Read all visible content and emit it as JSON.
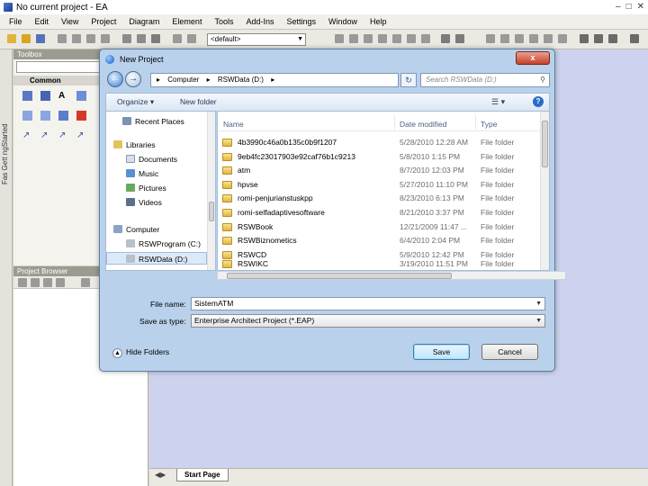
{
  "app": {
    "title": "No current project - EA",
    "menu": [
      "File",
      "Edit",
      "View",
      "Project",
      "Diagram",
      "Element",
      "Tools",
      "Add-Ins",
      "Settings",
      "Window",
      "Help"
    ],
    "toolbar_combo": "<default>",
    "sidebar_tab_text": "Fas Gett ngStarted",
    "toolbox_title": "Toolbox",
    "toolbox_group": "Common",
    "project_browser_title": "Project Browser",
    "start_page_tab": "Start Page"
  },
  "dialog": {
    "title": "New Project",
    "close_label": "x",
    "address": [
      "Computer",
      "RSWData (D:)"
    ],
    "search_placeholder": "Search RSWData (D:)",
    "organize_label": "Organize",
    "new_folder_label": "New folder",
    "nav_items": [
      {
        "label": "Recent Places",
        "icon": "recent-places-icon"
      },
      {
        "label": "Libraries",
        "icon": "libraries-icon"
      },
      {
        "label": "Documents",
        "icon": "documents-icon"
      },
      {
        "label": "Music",
        "icon": "music-icon"
      },
      {
        "label": "Pictures",
        "icon": "pictures-icon"
      },
      {
        "label": "Videos",
        "icon": "videos-icon"
      },
      {
        "label": "Computer",
        "icon": "computer-icon"
      },
      {
        "label": "RSWProgram (C:)",
        "icon": "drive-icon"
      },
      {
        "label": "RSWData (D:)",
        "icon": "drive-icon",
        "selected": true
      }
    ],
    "columns": {
      "name": "Name",
      "date": "Date modified",
      "type": "Type"
    },
    "files": [
      {
        "name": "4b3990c46a0b135c0b9f1207",
        "date": "5/28/2010 12:28 AM",
        "type": "File folder"
      },
      {
        "name": "9eb4fc23017903e92caf76b1c9213",
        "date": "5/8/2010 1:15 PM",
        "type": "File folder"
      },
      {
        "name": "atm",
        "date": "8/7/2010 12:03 PM",
        "type": "File folder"
      },
      {
        "name": "hpvse",
        "date": "5/27/2010 11:10 PM",
        "type": "File folder"
      },
      {
        "name": "romi-penjurianstuskpp",
        "date": "8/23/2010 6:13 PM",
        "type": "File folder"
      },
      {
        "name": "romi-selfadaptivesoftware",
        "date": "8/21/2010 3:37 PM",
        "type": "File folder"
      },
      {
        "name": "RSWBook",
        "date": "12/21/2009 11:47 ...",
        "type": "File folder"
      },
      {
        "name": "RSWBiznometics",
        "date": "6/4/2010 2:04 PM",
        "type": "File folder"
      },
      {
        "name": "RSWCD",
        "date": "5/9/2010 12:42 PM",
        "type": "File folder"
      },
      {
        "name": "RSWIKC",
        "date": "3/19/2010 11:51 PM",
        "type": "File folder"
      }
    ],
    "file_name_label": "File name:",
    "file_name_value": "SistemATM",
    "save_type_label": "Save as type:",
    "save_type_value": "Enterprise Architect Project (*.EAP)",
    "hide_folders_label": "Hide Folders",
    "save_label": "Save",
    "cancel_label": "Cancel"
  }
}
